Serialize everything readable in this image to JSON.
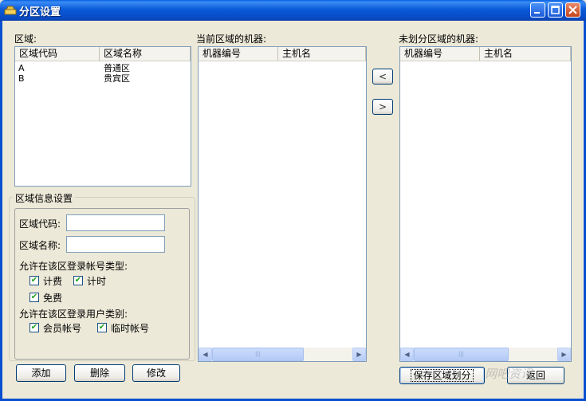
{
  "window": {
    "title": "分区设置"
  },
  "zones": {
    "label": "区域:",
    "columns": [
      "区域代码",
      "区域名称"
    ],
    "rows": [
      {
        "code": "A",
        "name": "普通区"
      },
      {
        "code": "B",
        "name": "贵宾区"
      }
    ]
  },
  "current_machines": {
    "label": "当前区域的机器:",
    "columns": [
      "机器编号",
      "主机名"
    ]
  },
  "unassigned_machines": {
    "label": "未划分区域的机器:",
    "columns": [
      "机器编号",
      "主机名"
    ]
  },
  "move_buttons": {
    "left": "<",
    "right": ">"
  },
  "zone_info": {
    "title": "区域信息设置",
    "code_label": "区域代码:",
    "code_value": "",
    "name_label": "区域名称:",
    "name_value": "",
    "account_types_label": "允许在该区登录帐号类型:",
    "account_types": [
      {
        "label": "计费",
        "checked": true
      },
      {
        "label": "计时",
        "checked": true
      },
      {
        "label": "免费",
        "checked": true
      }
    ],
    "user_types_label": "允许在该区登录用户类别:",
    "user_types": [
      {
        "label": "会员帐号",
        "checked": true
      },
      {
        "label": "临时帐号",
        "checked": true
      }
    ]
  },
  "actions": {
    "add": "添加",
    "delete": "删除",
    "modify": "修改",
    "save": "保存区域划分",
    "back": "返回"
  },
  "scroll_grip": "|||",
  "watermark": "网吧资讯"
}
